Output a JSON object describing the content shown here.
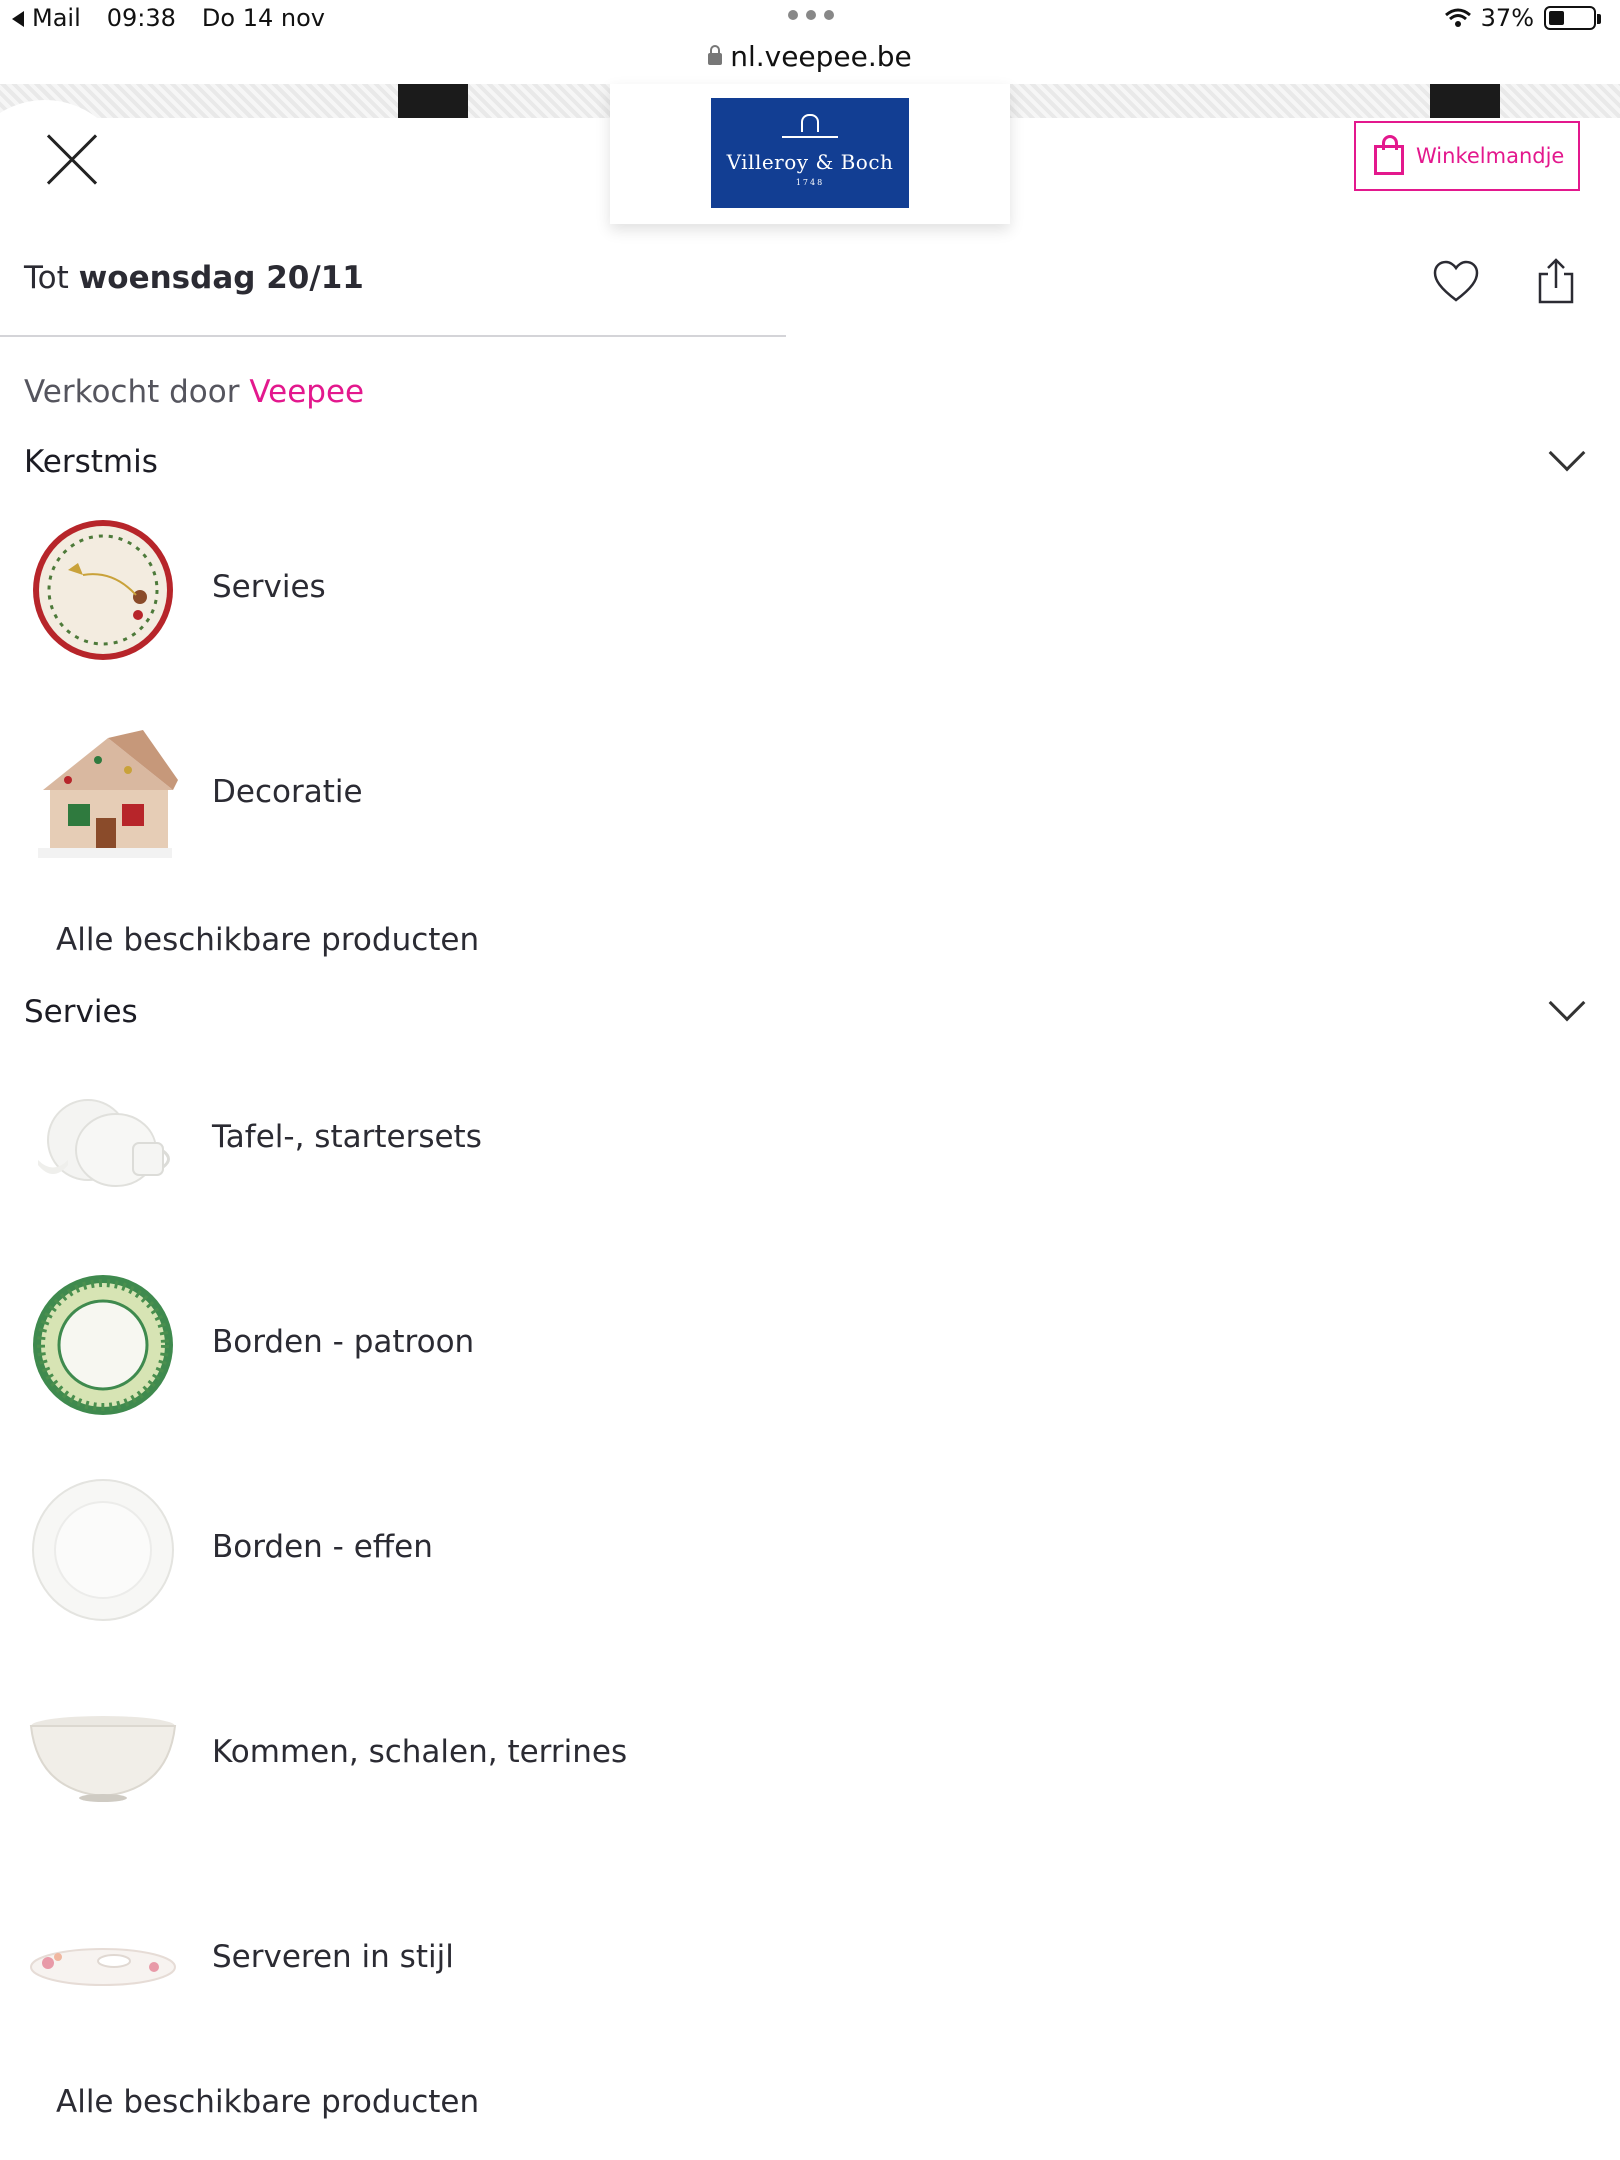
{
  "status_bar": {
    "back_app": "Mail",
    "time": "09:38",
    "date": "Do 14 nov",
    "battery": "37%"
  },
  "browser": {
    "url": "nl.veepee.be"
  },
  "logo": {
    "name": "Villeroy & Boch",
    "year": "1748"
  },
  "header": {
    "cart_label": "Winkelmandje"
  },
  "deadline": {
    "prefix": "Tot",
    "date": "woensdag 20/11"
  },
  "seller": {
    "prefix": "Verkocht door",
    "brand": "Veepee"
  },
  "sections": [
    {
      "title": "Kerstmis",
      "items": [
        {
          "label": "Servies",
          "icon": "christmas-plate"
        },
        {
          "label": "Decoratie",
          "icon": "gingerbread-house"
        }
      ],
      "all_label": "Alle beschikbare producten"
    },
    {
      "title": "Servies",
      "items": [
        {
          "label": "Tafel-, startersets",
          "icon": "table-set"
        },
        {
          "label": "Borden - patroon",
          "icon": "patterned-plate"
        },
        {
          "label": "Borden - effen",
          "icon": "plain-plate"
        },
        {
          "label": "Kommen, schalen, terrines",
          "icon": "bowl"
        },
        {
          "label": "Serveren in stijl",
          "icon": "serving-dish"
        }
      ],
      "all_label": "Alle beschikbare producten"
    }
  ],
  "colors": {
    "accent": "#e3188d",
    "logo_blue": "#123e93",
    "text": "#2b2b33"
  }
}
